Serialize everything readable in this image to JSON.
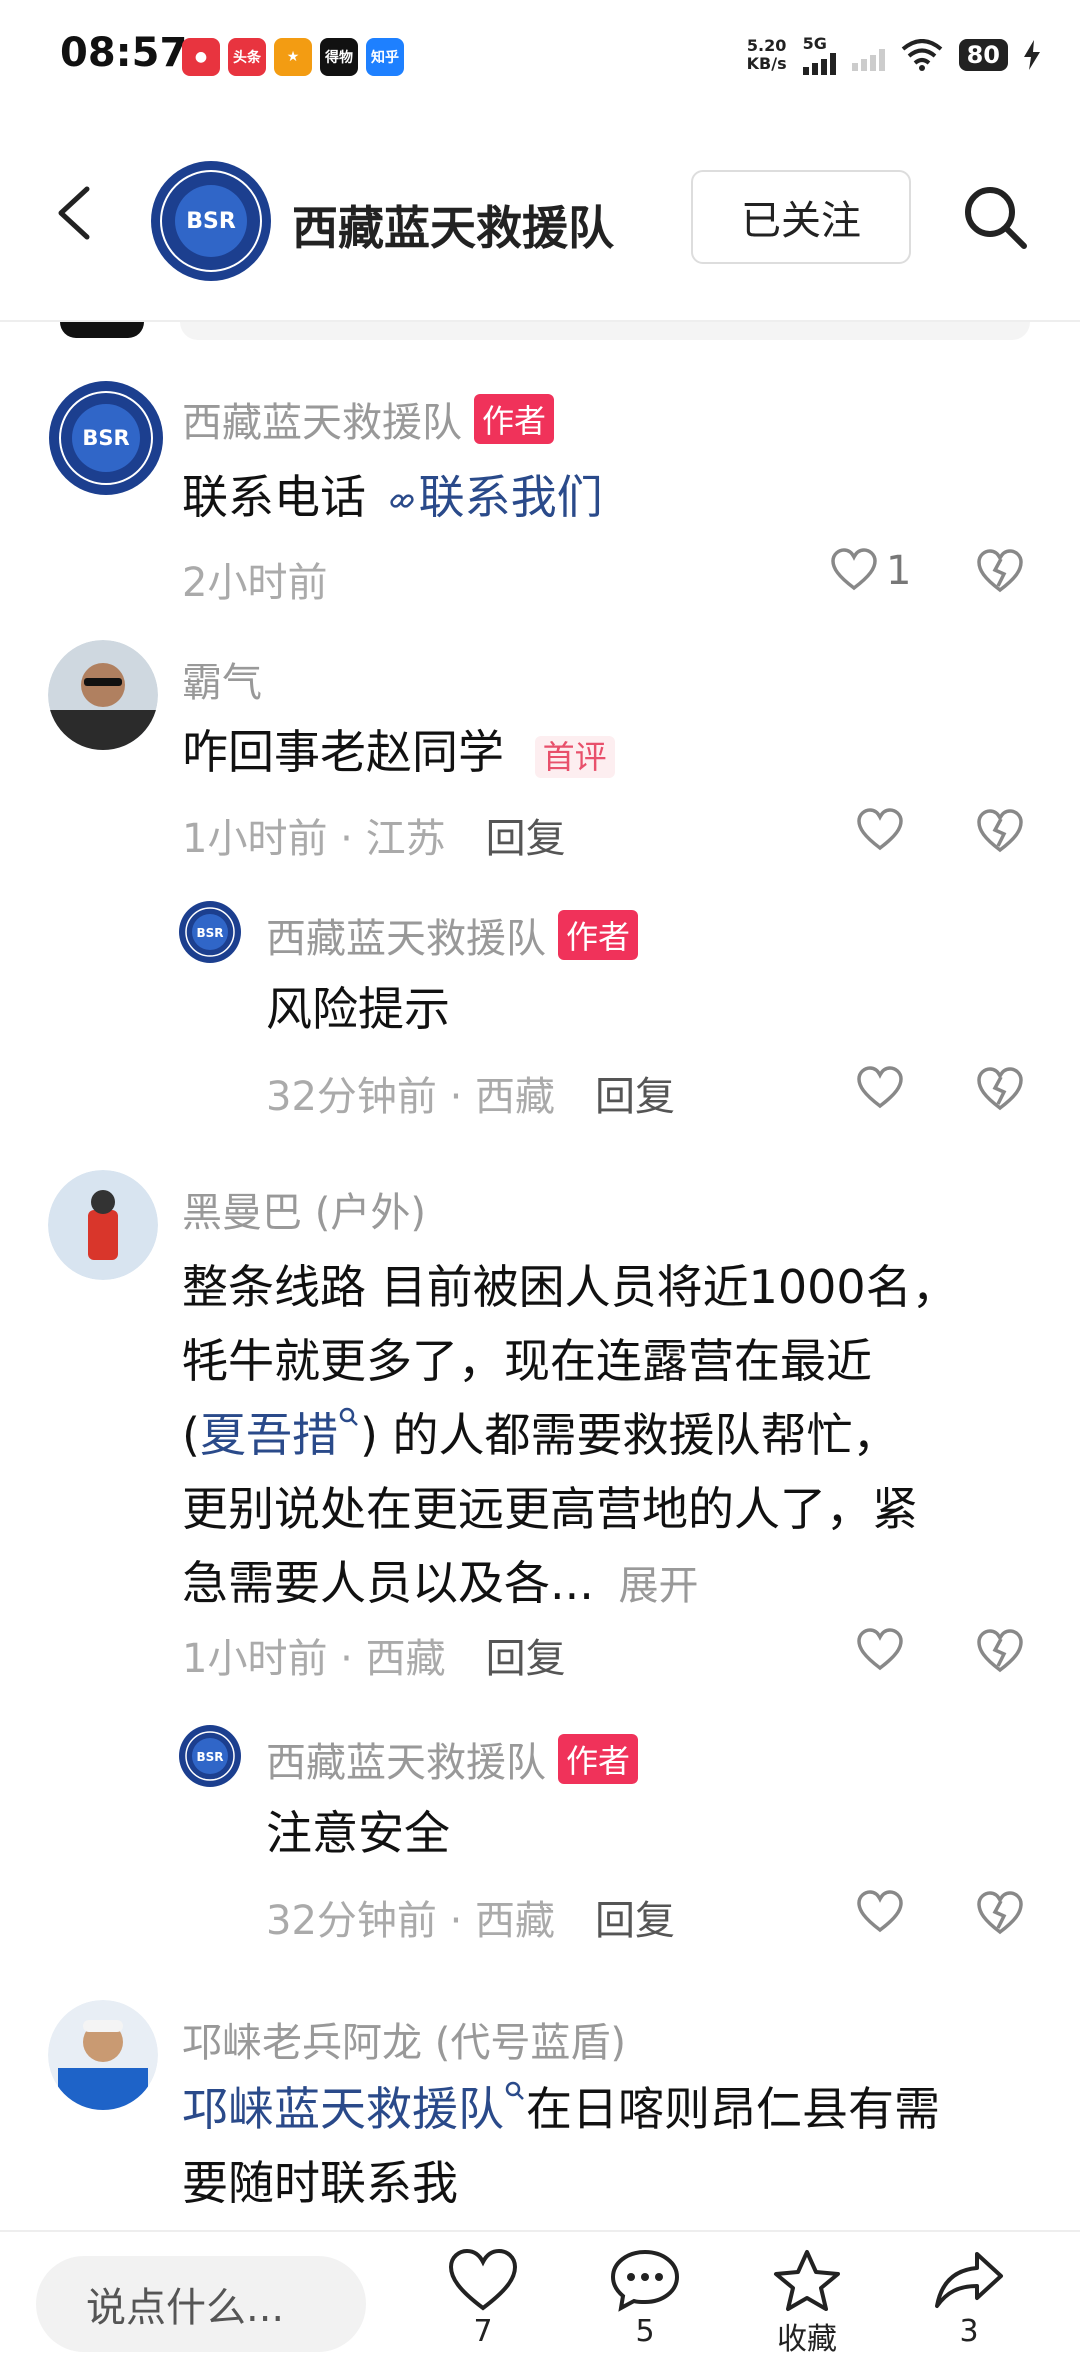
{
  "status": {
    "time": "08:57",
    "apps": [
      "头条",
      "得物",
      "知乎"
    ],
    "net_speed": "5.20",
    "net_unit": "KB/s",
    "network": "5G",
    "battery": "80"
  },
  "header": {
    "title": "西藏蓝天救援队",
    "follow_label": "已关注"
  },
  "comments": [
    {
      "name": "西藏蓝天救援队",
      "badge": "作者",
      "text_a": "联系电话",
      "link": "联系我们",
      "time": "2小时前",
      "like_count": "1"
    },
    {
      "name": "霸气",
      "text": "咋回事老赵同学",
      "badge": "首评",
      "time": "1小时前 · 江苏",
      "reply": "回复"
    },
    {
      "name": "西藏蓝天救援队",
      "badge": "作者",
      "text": "风险提示",
      "time": "32分钟前 · 西藏",
      "reply": "回复"
    },
    {
      "name": "黑曼巴 (户外)",
      "line1": "整条线路 目前被困人员将近1000名，",
      "line2": "牦牛就更多了，现在连露营在最近",
      "line3_pre": "(",
      "line3_link": "夏吾措",
      "line3_post": ") 的人都需要救援队帮忙，",
      "line4": "更别说处在更远更高营地的人了，紧",
      "line5": "急需要人员以及各...",
      "expand": "展开",
      "time": "1小时前 · 西藏",
      "reply": "回复"
    },
    {
      "name": "西藏蓝天救援队",
      "badge": "作者",
      "text": "注意安全",
      "time": "32分钟前 · 西藏",
      "reply": "回复"
    },
    {
      "name": "邛崃老兵阿龙 (代号蓝盾)",
      "link": "邛崃蓝天救援队",
      "text_a": "在日喀则昂仁县有需",
      "text_b": "要随时联系我"
    }
  ],
  "bottom": {
    "input_placeholder": "说点什么...",
    "like_count": "7",
    "comment_count": "5",
    "collect_label": "收藏",
    "share_count": "3"
  },
  "colors": {
    "author_badge": "#f0325a",
    "link": "#2a4a8a"
  }
}
